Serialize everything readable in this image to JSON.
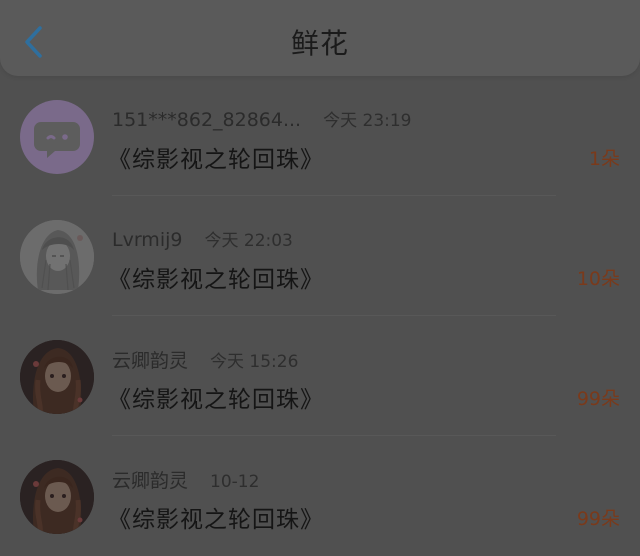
{
  "header": {
    "title": "鲜花"
  },
  "colors": {
    "accent": "#2f6f9e",
    "count": "#7a3a1b",
    "background": "#505050"
  },
  "items": [
    {
      "username": "151***862_82864...",
      "time": "今天 23:19",
      "book": "《综影视之轮回珠》",
      "count": "1朵",
      "avatar": "default-chat-avatar"
    },
    {
      "username": "Lvrmij9",
      "time": "今天 22:03",
      "book": "《综影视之轮回珠》",
      "count": "10朵",
      "avatar": "sketch-girl-avatar"
    },
    {
      "username": "云卿韵灵",
      "time": "今天 15:26",
      "book": "《综影视之轮回珠》",
      "count": "99朵",
      "avatar": "anime-girl-avatar"
    },
    {
      "username": "云卿韵灵",
      "time": "10-12",
      "book": "《综影视之轮回珠》",
      "count": "99朵",
      "avatar": "anime-girl-avatar"
    }
  ]
}
